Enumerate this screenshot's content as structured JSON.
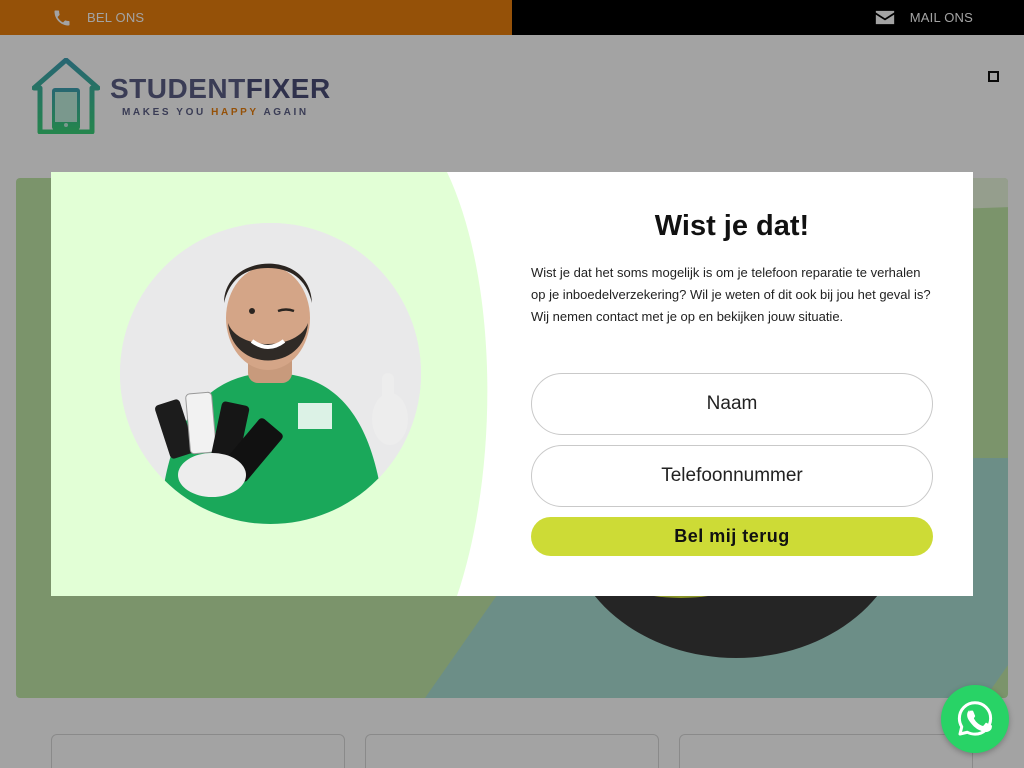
{
  "topbar": {
    "call_label": "BEL ONS",
    "mail_label": "MAIL ONS",
    "left_color": "#e97f0e",
    "right_color": "#000000"
  },
  "logo": {
    "brand_part1": "STUDENT",
    "brand_part2": "FIXER",
    "tagline_part1": "MAKES YOU ",
    "tagline_part2": "HAPPY",
    "tagline_part3": " AGAIN"
  },
  "modal": {
    "title": "Wist je dat!",
    "body": "Wist je dat het soms mogelijk is om je telefoon reparatie te verhalen op je inboedelverzekering? Wil je weten of dit ook bij jou het geval is? Wij nemen contact met je op en bekijken jouw situatie.",
    "name_placeholder": "Naam",
    "phone_placeholder": "Telefoonnummer",
    "submit_label": "Bel mij terug",
    "accent_color": "#cddb36",
    "left_panel_color": "#e2ffd6"
  },
  "icons": {
    "phone": "phone-icon",
    "mail": "mail-icon",
    "menu": "menu-toggle-icon",
    "whatsapp": "whatsapp-icon"
  },
  "whatsapp": {
    "color": "#28d366"
  }
}
